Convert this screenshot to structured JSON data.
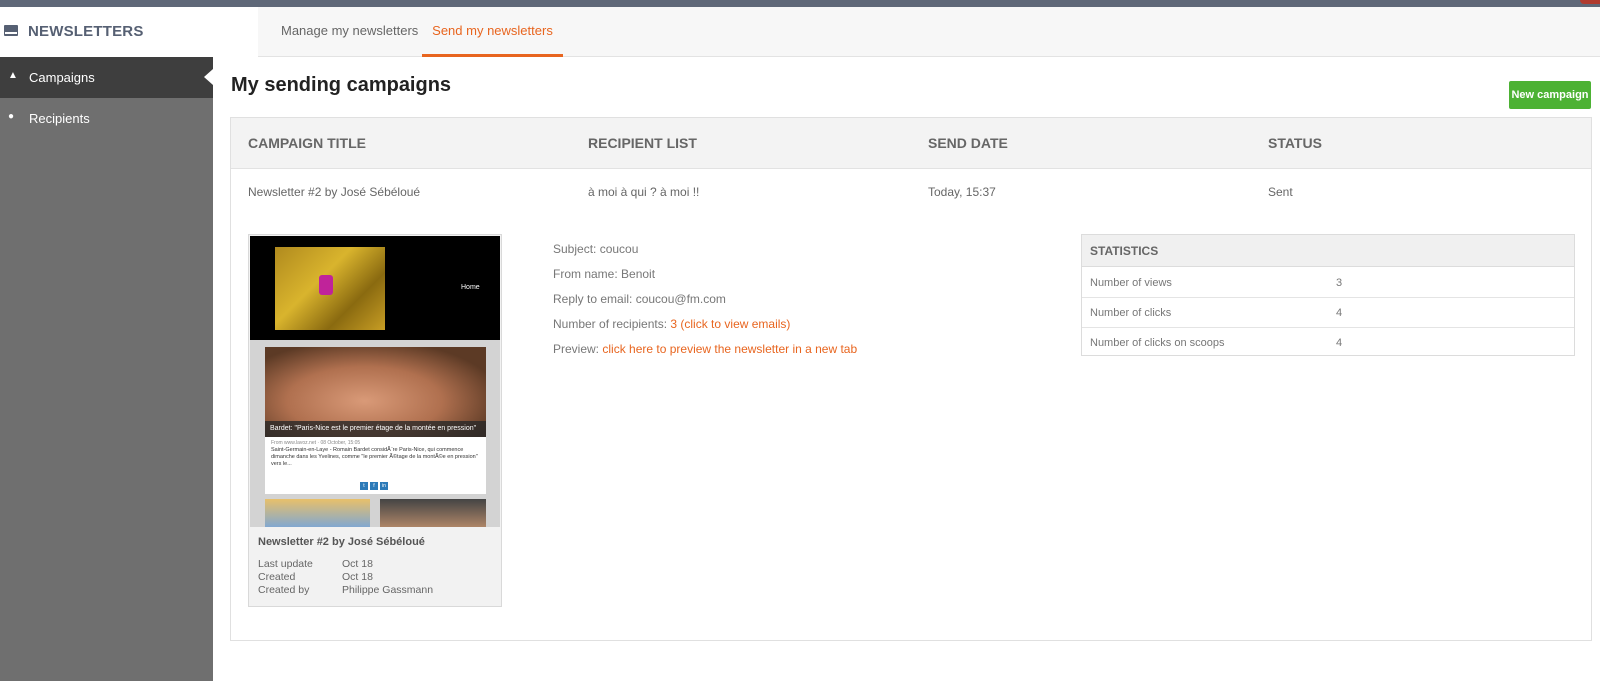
{
  "app": {
    "title": "NEWSLETTERS",
    "icon": "envelope-icon"
  },
  "tabs": [
    {
      "label": "Manage my newsletters",
      "active": false
    },
    {
      "label": "Send my newsletters",
      "active": true
    }
  ],
  "sidebar": {
    "items": [
      {
        "label": "Campaigns",
        "icon": "campaigns-icon",
        "active": true
      },
      {
        "label": "Recipients",
        "icon": "recipients-icon",
        "active": false
      }
    ]
  },
  "page": {
    "title": "My sending campaigns",
    "new_button": "New campaign"
  },
  "table": {
    "headers": [
      "CAMPAIGN TITLE",
      "RECIPIENT LIST",
      "SEND DATE",
      "STATUS"
    ],
    "row": {
      "title": "Newsletter #2 by José Sébéloué",
      "recipient_list": "à moi à qui ? à moi !!",
      "send_date": "Today, 15:37",
      "status": "Sent"
    }
  },
  "preview_card": {
    "hero_nav": "Home",
    "article_caption": "Bardet: \"Paris-Nice est le premier étage de la montée en pression\"",
    "article_meta": "From www.lavoz.net · 08 October, 15:05",
    "article_text": "Saint-Germain-en-Laye - Romain Bardet considÃ¨re Paris-Nice, qui commence dimanche dans les Yvelines, comme \"le premier Ã©tage de la montÃ©e en pression\" vers le...",
    "name": "Newsletter #2 by José Sébéloué",
    "last_update_label": "Last update",
    "last_update_value": "Oct 18",
    "created_label": "Created",
    "created_value": "Oct 18",
    "created_by_label": "Created by",
    "created_by_value": "Philippe Gassmann"
  },
  "details": {
    "subject": "Subject: coucou",
    "from_name": "From name: Benoit",
    "reply_to": "Reply to email: coucou@fm.com",
    "recipients_label": "Number of recipients: ",
    "recipients_link": "3 (click to view emails)",
    "preview_label": "Preview: ",
    "preview_link": "click here to preview the newsletter in a new tab"
  },
  "statistics": {
    "title": "STATISTICS",
    "rows": [
      {
        "label": "Number of views",
        "value": "3"
      },
      {
        "label": "Number of clicks",
        "value": "4"
      },
      {
        "label": "Number of clicks on scoops",
        "value": "4"
      }
    ]
  },
  "colors": {
    "accent": "#e8651f",
    "new_button": "#4db234",
    "sidebar": "#6f6f6f",
    "sidebar_active": "#3e3e3e",
    "brand": "#566073"
  }
}
